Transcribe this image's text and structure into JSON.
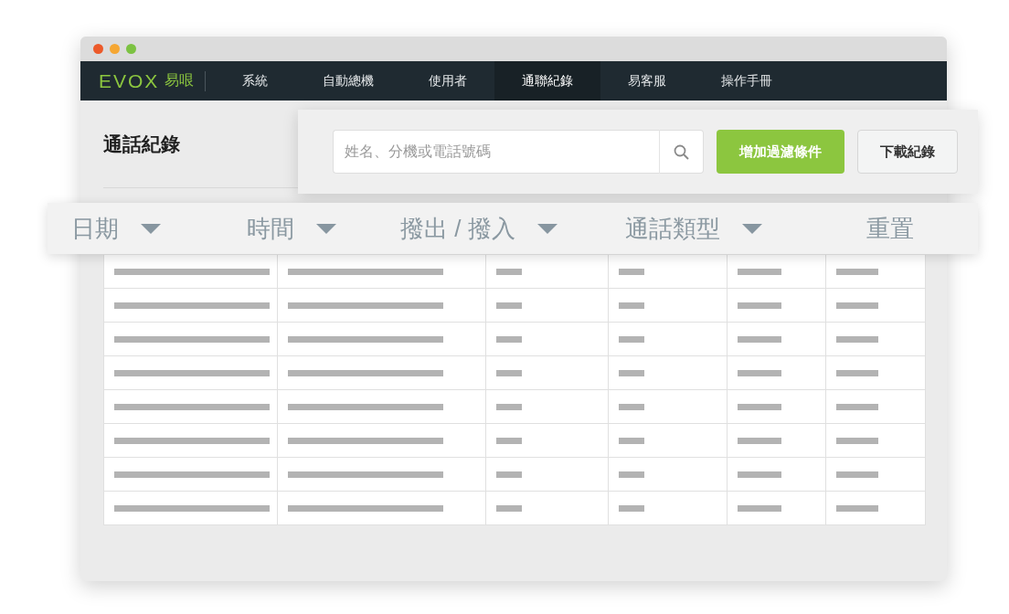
{
  "nav": {
    "logo": "EVOX",
    "logo_suffix": "易哏",
    "items": [
      {
        "label": "系統",
        "selected": false
      },
      {
        "label": "自動總機",
        "selected": false
      },
      {
        "label": "使用者",
        "selected": false
      },
      {
        "label": "通聯紀錄",
        "selected": true
      },
      {
        "label": "易客服",
        "selected": false
      },
      {
        "label": "操作手冊",
        "selected": false
      }
    ]
  },
  "page": {
    "title": "通話紀錄"
  },
  "toolbar": {
    "search": {
      "placeholder": "姓名、分機或電話號碼"
    },
    "buttons": [
      {
        "label": "增加過濾條件",
        "kind": "primary"
      },
      {
        "label": "下載紀錄",
        "kind": "secondary"
      }
    ]
  },
  "filters": [
    {
      "label": "日期",
      "kind": "dropdown"
    },
    {
      "label": "時間",
      "kind": "dropdown"
    },
    {
      "label": "撥出 / 撥入",
      "kind": "dropdown"
    },
    {
      "label": "通話類型",
      "kind": "dropdown"
    },
    {
      "label": "重置",
      "kind": "reset"
    }
  ],
  "table": {
    "rows": [
      {
        "loading": true
      },
      {
        "loading": true
      },
      {
        "loading": true
      },
      {
        "loading": true
      },
      {
        "loading": true
      },
      {
        "loading": true
      },
      {
        "loading": true
      },
      {
        "loading": true
      }
    ]
  }
}
